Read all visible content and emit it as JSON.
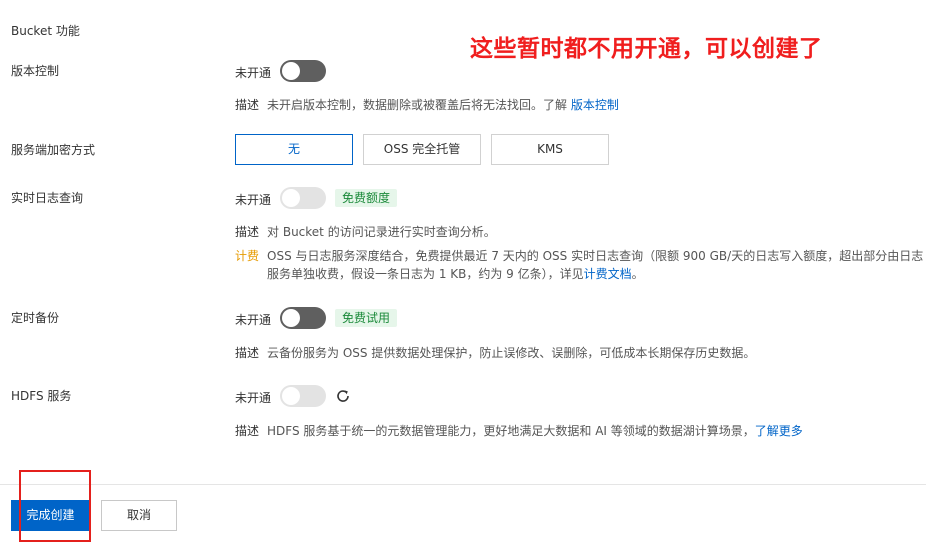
{
  "section": {
    "title": "Bucket 功能"
  },
  "annotation": {
    "text": "这些暂时都不用开通，可以创建了"
  },
  "versioning": {
    "label": "版本控制",
    "status": "未开通",
    "desc_key": "描述",
    "desc_text": "未开启版本控制，数据删除或被覆盖后将无法找回。了解 ",
    "desc_link": "版本控制"
  },
  "encryption": {
    "label": "服务端加密方式",
    "options": [
      "无",
      "OSS 完全托管",
      "KMS"
    ],
    "selected": "无"
  },
  "realtime_log": {
    "label": "实时日志查询",
    "status": "未开通",
    "badge": "免费额度",
    "desc_key": "描述",
    "desc_text": "对 Bucket 的访问记录进行实时查询分析。",
    "billing_key": "计费",
    "billing_line1": "OSS 与日志服务深度结合，免费提供最近 7 天内的 OSS 实时日志查询（限额 900 GB/天的日志写入额度，超出部分由日志",
    "billing_line2": "服务单独收费，假设一条日志为 1 KB，约为 9 亿条），详见",
    "billing_link": "计费文档",
    "billing_end": "。"
  },
  "backup": {
    "label": "定时备份",
    "status": "未开通",
    "badge": "免费试用",
    "desc_key": "描述",
    "desc_text": "云备份服务为 OSS 提供数据处理保护，防止误修改、误删除，可低成本长期保存历史数据。"
  },
  "hdfs": {
    "label": "HDFS 服务",
    "status": "未开通",
    "desc_key": "描述",
    "desc_text": "HDFS 服务基于统一的元数据管理能力，更好地满足大数据和 AI 等领域的数据湖计算场景，",
    "desc_link": "了解更多"
  },
  "footer": {
    "confirm_label": "完成创建",
    "cancel_label": "取消"
  },
  "colors": {
    "primary": "#0064c8",
    "annotation": "#f01e1e",
    "badge_bg": "#e6f6ea",
    "badge_text": "#1b8a3a",
    "billing": "#e69a00"
  }
}
